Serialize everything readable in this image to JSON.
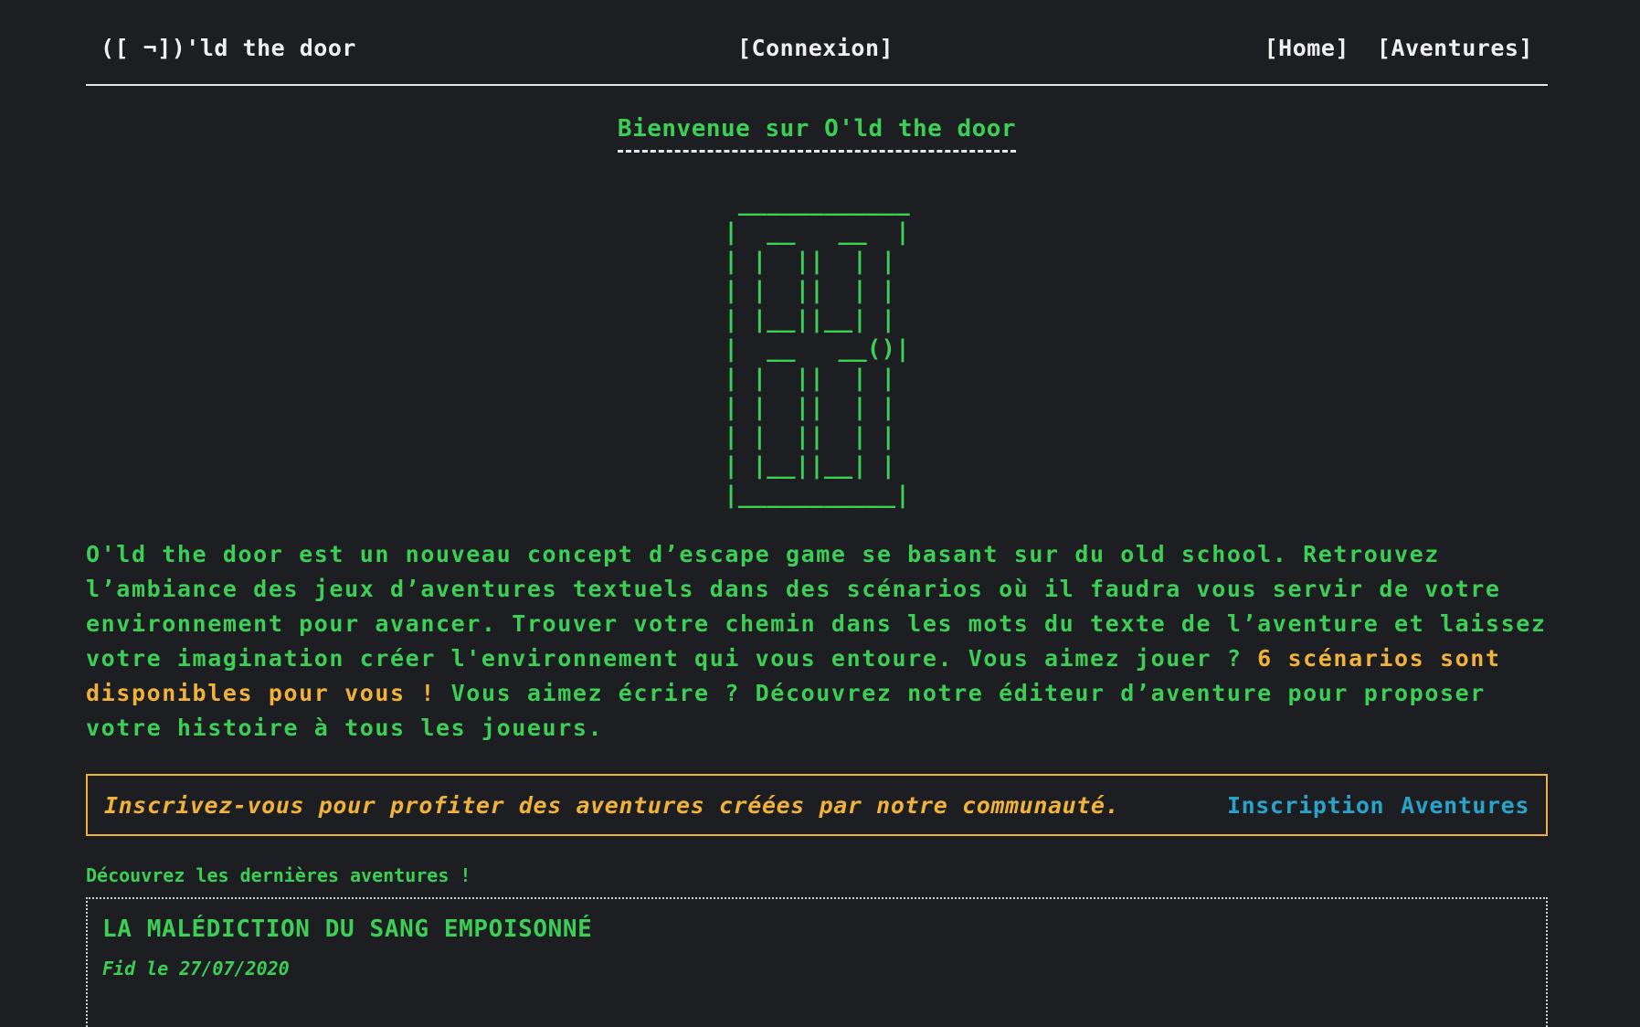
{
  "header": {
    "brand": "([ ¬])'ld the door",
    "connexion": "[Connexion]",
    "nav": {
      "home": "[Home]",
      "aventures": "[Aventures]"
    }
  },
  "welcome": {
    "title": "Bienvenue sur O'ld the door"
  },
  "door_art": " ____________\n|  __   __  |\n| |  ||  | |\n| |  ||  | |\n| |__||__| |\n|  __   __()|\n| |  ||  | |\n| |  ||  | |\n| |  ||  | |\n| |__||__| |\n|___________|",
  "intro": {
    "text_before": "O'ld the door est un nouveau concept d’escape game se basant sur du old school. Retrouvez l’ambiance des jeux d’aventures textuels dans des scénarios où il faudra vous servir de votre environnement pour avancer. Trouver votre chemin dans les mots du texte de l’aventure et laissez votre imagination créer l'environnement qui vous entoure. Vous aimez jouer ? ",
    "highlight": "6 scénarios sont disponibles pour vous !",
    "text_after": " Vous aimez écrire ? Découvrez notre éditeur d’aventure pour proposer votre histoire à tous les joueurs."
  },
  "banner": {
    "message": "Inscrivez-vous pour profiter des aventures créées par notre communauté.",
    "inscription_link": "Inscription",
    "aventures_link": "Aventures"
  },
  "latest": {
    "heading": "Découvrez les dernières aventures !",
    "items": [
      {
        "title": "LA MALÉDICTION DU SANG EMPOISONNÉ",
        "meta": "Fid le 27/07/2020"
      }
    ]
  },
  "colors": {
    "background": "#1d1e22",
    "green": "#3dcf55",
    "orange": "#f0b23a",
    "blue": "#2ba3c9",
    "white": "#f0f0f0"
  }
}
